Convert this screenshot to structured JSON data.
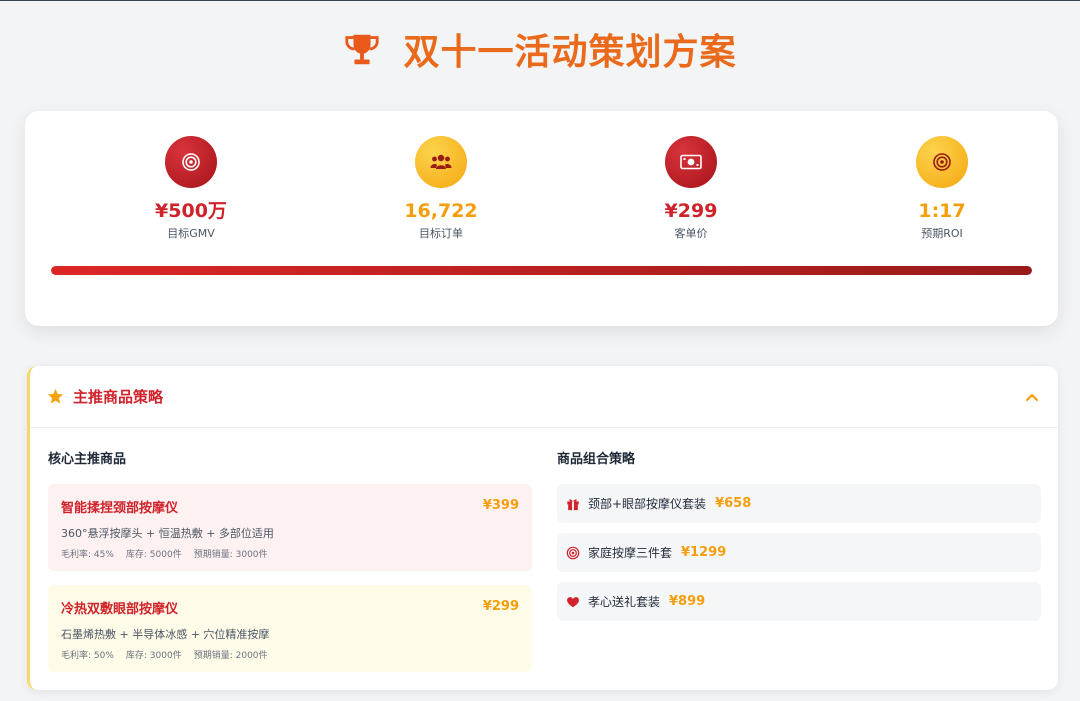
{
  "page": {
    "title": "双十一活动策划方案"
  },
  "kpis": [
    {
      "icon": "target-icon",
      "value": "¥500万",
      "label": "目标GMV",
      "tone": "red"
    },
    {
      "icon": "users-icon",
      "value": "16,722",
      "label": "目标订单",
      "tone": "yellow"
    },
    {
      "icon": "money-bill-icon",
      "value": "¥299",
      "label": "客单价",
      "tone": "red"
    },
    {
      "icon": "target-icon",
      "value": "1:17",
      "label": "预期ROI",
      "tone": "yellow"
    }
  ],
  "progress": {
    "percent": 100
  },
  "strategy": {
    "title": "主推商品策略",
    "left_title": "核心主推商品",
    "right_title": "商品组合策略",
    "products": [
      {
        "name": "智能揉捏颈部按摩仪",
        "price": "¥399",
        "desc": "360°悬浮按摩头 + 恒温热敷 + 多部位适用",
        "margin": "毛利率: 45%",
        "stock": "库存: 5000件",
        "sales": "预期销量: 3000件",
        "bg": "pink"
      },
      {
        "name": "冷热双敷眼部按摩仪",
        "price": "¥299",
        "desc": "石墨烯热敷 + 半导体冰感 + 穴位精准按摩",
        "margin": "毛利率: 50%",
        "stock": "库存: 3000件",
        "sales": "预期销量: 2000件",
        "bg": "cream"
      }
    ],
    "combos": [
      {
        "icon": "gift-icon",
        "name": "颈部+眼部按摩仪套装",
        "price": "¥658"
      },
      {
        "icon": "bullseye-icon",
        "name": "家庭按摩三件套",
        "price": "¥1299"
      },
      {
        "icon": "heart-icon",
        "name": "孝心送礼套装",
        "price": "¥899"
      }
    ]
  },
  "colors": {
    "brand_red": "#d0222a",
    "accent_orange": "#ea6a1b",
    "accent_yellow": "#f59e0b"
  }
}
